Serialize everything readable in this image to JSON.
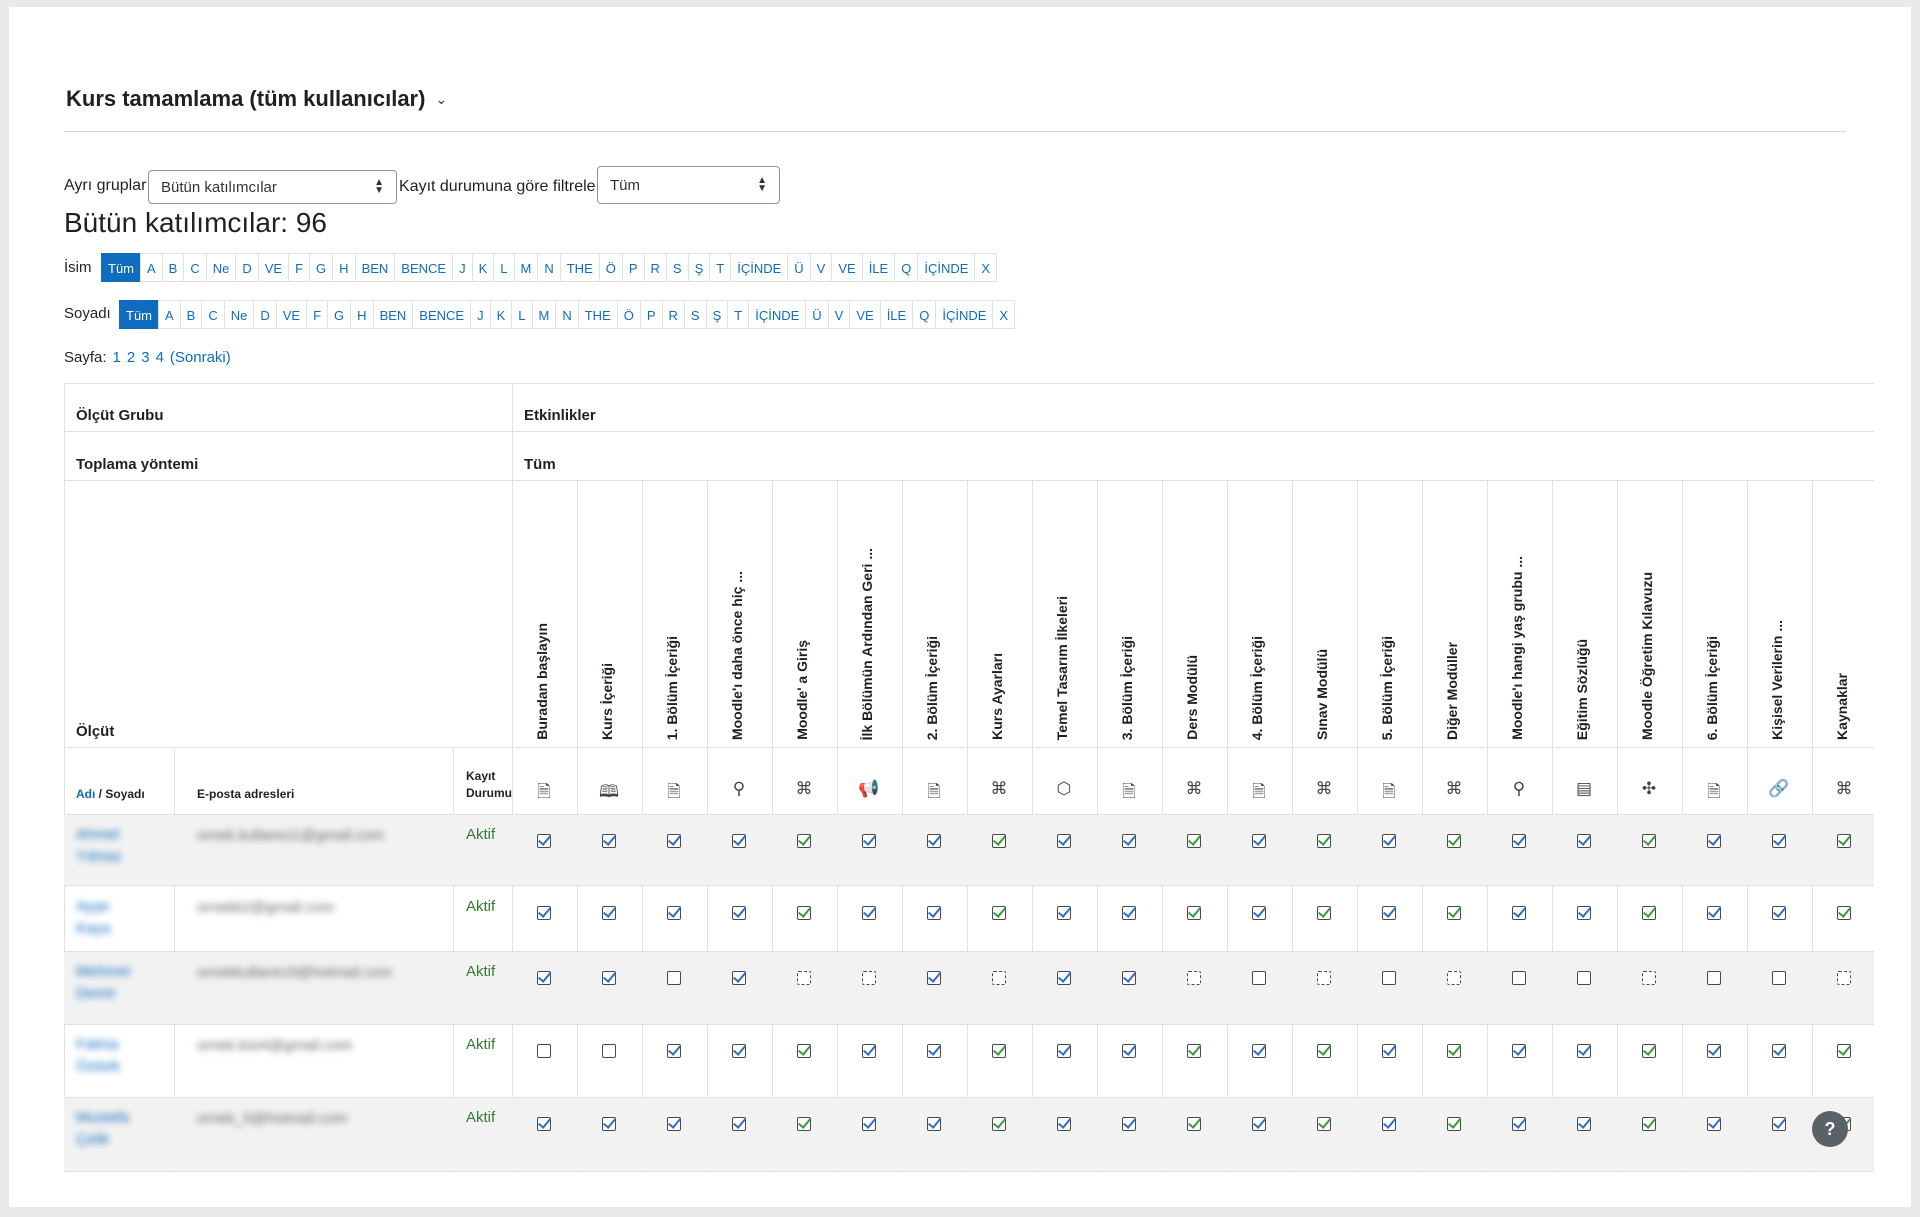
{
  "title": "Kurs tamamlama (tüm kullanıcılar)",
  "filters": {
    "groups_label": "Ayrı gruplar",
    "groups_value": "Bütün katılımcılar",
    "status_label": "Kayıt durumuna göre filtrele:",
    "status_value": "Tüm"
  },
  "participants_title": "Bütün katılımcılar: 96",
  "initials": {
    "first_label": "İsim",
    "last_label": "Soyadı",
    "letters": [
      "Tüm",
      "A",
      "B",
      "C",
      "Ne",
      "D",
      "VE",
      "F",
      "G",
      "H",
      "BEN",
      "BENCE",
      "J",
      "K",
      "L",
      "M",
      "N",
      "THE",
      "Ö",
      "P",
      "R",
      "S",
      "Ş",
      "T",
      "İÇİNDE",
      "Ü",
      "V",
      "VE",
      "İLE",
      "Q",
      "İÇİNDE",
      "X"
    ]
  },
  "pager": {
    "label": "Sayfa:",
    "pages": [
      "1",
      "2",
      "3",
      "4"
    ],
    "next": "(Sonraki)"
  },
  "table": {
    "criteria_group_label": "Ölçüt Grubu",
    "criteria_group_value": "Etkinlikler",
    "aggregation_label": "Toplama yöntemi",
    "aggregation_value": "Tüm",
    "criteria_label": "Ölçüt",
    "name_header_first": "Adı",
    "name_header_sep": " / ",
    "name_header_last": "Soyadı",
    "email_header": "E-posta adresleri",
    "status_header_1": "Kayıt",
    "status_header_2": "Durumu",
    "columns": [
      {
        "label": "Buradan başlayın",
        "icon": "page-icon",
        "glyph": "🗎"
      },
      {
        "label": "Kurs İçeriği",
        "icon": "book-icon",
        "glyph": "🕮"
      },
      {
        "label": "1. Bölüm İçeriği",
        "icon": "page-icon",
        "glyph": "🗎"
      },
      {
        "label": "Moodle'ı daha önce hiç ...",
        "icon": "choice-icon",
        "glyph": "⚲"
      },
      {
        "label": "Moodle' a Giriş",
        "icon": "scorm-icon",
        "glyph": "⌘"
      },
      {
        "label": "İlk Bölümün Ardından Geri ...",
        "icon": "feedback-icon",
        "glyph": "📢"
      },
      {
        "label": "2. Bölüm İçeriği",
        "icon": "page-icon",
        "glyph": "🗎"
      },
      {
        "label": "Kurs Ayarları",
        "icon": "scorm-icon",
        "glyph": "⌘"
      },
      {
        "label": "Temel Tasarım İlkeleri",
        "icon": "package-icon",
        "glyph": "⬡"
      },
      {
        "label": "3. Bölüm İçeriği",
        "icon": "page-icon",
        "glyph": "🗎"
      },
      {
        "label": "Ders Modülü",
        "icon": "scorm-icon",
        "glyph": "⌘"
      },
      {
        "label": "4. Bölüm İçeriği",
        "icon": "page-icon",
        "glyph": "🗎"
      },
      {
        "label": "Sınav Modülü",
        "icon": "scorm-icon",
        "glyph": "⌘"
      },
      {
        "label": "5. Bölüm İçeriği",
        "icon": "page-icon",
        "glyph": "🗎"
      },
      {
        "label": "Diğer Modüller",
        "icon": "scorm-icon",
        "glyph": "⌘"
      },
      {
        "label": "Moodle'ı hangi yaş grubu ...",
        "icon": "choice-icon",
        "glyph": "⚲"
      },
      {
        "label": "Eğitim Sözlüğü",
        "icon": "glossary-icon",
        "glyph": "▤"
      },
      {
        "label": "Moodle Öğretim Kılavuzu",
        "icon": "h5p-icon",
        "glyph": "✣"
      },
      {
        "label": "6. Bölüm İçeriği",
        "icon": "page-icon",
        "glyph": "🗎"
      },
      {
        "label": "Kişisel Verilerin ...",
        "icon": "link-icon",
        "glyph": "🔗"
      },
      {
        "label": "Kaynaklar",
        "icon": "scorm-icon",
        "glyph": "⌘"
      }
    ],
    "rows": [
      {
        "name": "Ahmet Yılmaz",
        "email": "ornek.kullanici1@gmail.com",
        "status": "Aktif",
        "checks": [
          1,
          1,
          1,
          1,
          1,
          1,
          1,
          1,
          1,
          1,
          1,
          1,
          1,
          1,
          1,
          1,
          1,
          1,
          1,
          1,
          1
        ]
      },
      {
        "name": "Ayşe Kaya",
        "email": "ornekk2@gmail.com",
        "status": "Aktif",
        "checks": [
          1,
          1,
          1,
          1,
          1,
          1,
          1,
          1,
          1,
          1,
          1,
          1,
          1,
          1,
          1,
          1,
          1,
          1,
          1,
          1,
          1
        ]
      },
      {
        "name": "Mehmet Demir",
        "email": "ornekkullanici3@hotmail.com",
        "status": "Aktif",
        "checks": [
          1,
          1,
          0,
          1,
          0,
          0,
          1,
          0,
          1,
          1,
          0,
          0,
          0,
          0,
          0,
          0,
          0,
          0,
          0,
          0,
          0
        ]
      },
      {
        "name": "Fatma Öztürk",
        "email": "ornek.kisi4@gmail.com",
        "status": "Aktif",
        "checks": [
          0,
          0,
          1,
          1,
          1,
          1,
          1,
          1,
          1,
          1,
          1,
          1,
          1,
          1,
          1,
          1,
          1,
          1,
          1,
          1,
          1
        ]
      },
      {
        "name": "Mustafa Çelik",
        "email": "ornek_5@hotmail.com",
        "status": "Aktif",
        "checks": [
          1,
          1,
          1,
          1,
          1,
          1,
          1,
          1,
          1,
          1,
          1,
          1,
          1,
          1,
          1,
          1,
          1,
          1,
          1,
          1,
          1
        ]
      }
    ]
  },
  "help_label": "?"
}
